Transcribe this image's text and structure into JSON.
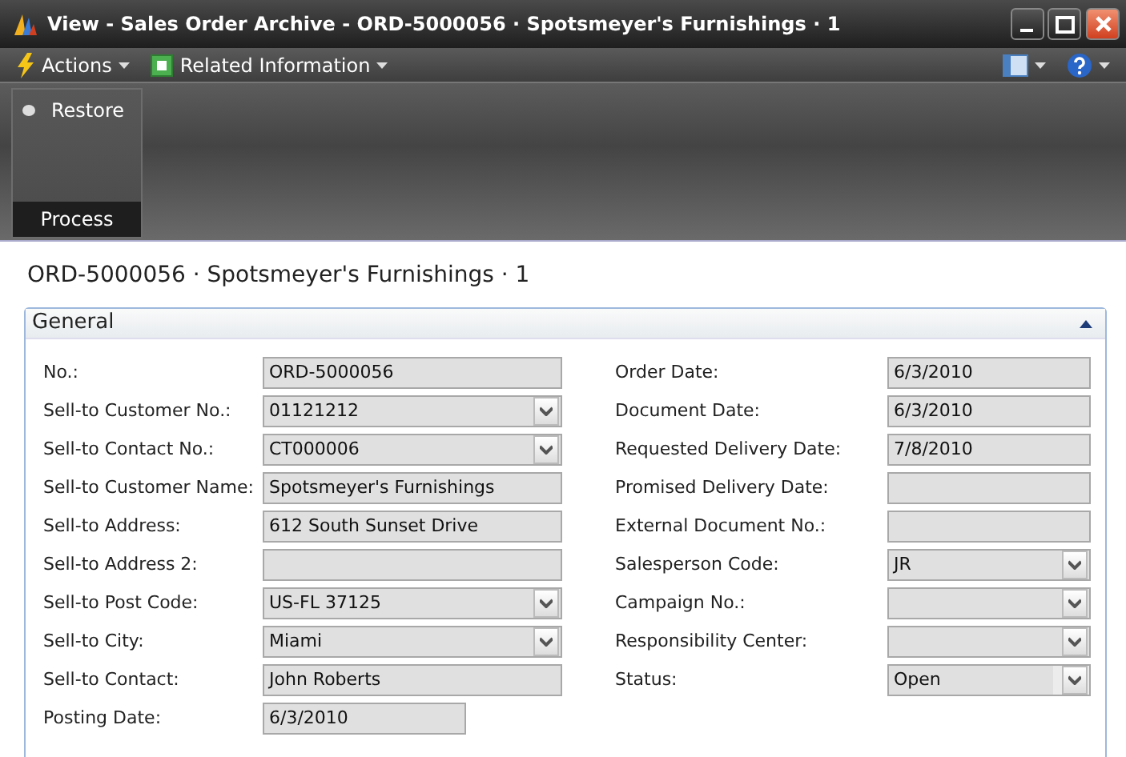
{
  "window": {
    "title": "View - Sales Order Archive - ORD-5000056 · Spotsmeyer's Furnishings · 1"
  },
  "toolbar": {
    "menus": [
      {
        "label": "Actions",
        "kind": "actions"
      },
      {
        "label": "Related Information",
        "kind": "related"
      }
    ]
  },
  "ribbon": {
    "groups": [
      {
        "label": "Process",
        "actions": [
          {
            "label": "Restore"
          }
        ]
      }
    ]
  },
  "page": {
    "title": "ORD-5000056 · Spotsmeyer's Furnishings · 1"
  },
  "fasttab": {
    "title": "General",
    "expanded": true,
    "columns": [
      [
        {
          "label": "No.:",
          "value": "ORD-5000056",
          "kind": "text"
        },
        {
          "label": "Sell-to Customer No.:",
          "value": "01121212",
          "kind": "lookup"
        },
        {
          "label": "Sell-to Contact No.:",
          "value": "CT000006",
          "kind": "lookup"
        },
        {
          "label": "Sell-to Customer Name:",
          "value": "Spotsmeyer's Furnishings",
          "kind": "text"
        },
        {
          "label": "Sell-to Address:",
          "value": "612 South Sunset Drive",
          "kind": "text"
        },
        {
          "label": "Sell-to Address 2:",
          "kind": "text"
        },
        {
          "label": "Sell-to Post Code:",
          "value": "US-FL 37125",
          "kind": "lookup"
        },
        {
          "label": "Sell-to City:",
          "value": "Miami",
          "kind": "lookup"
        },
        {
          "label": "Sell-to Contact:",
          "value": "John Roberts",
          "kind": "text"
        },
        {
          "label": "Posting Date:",
          "value": "6/3/2010",
          "kind": "date"
        }
      ],
      [
        {
          "label": "Order Date:",
          "value": "6/3/2010",
          "kind": "text"
        },
        {
          "label": "Document Date:",
          "value": "6/3/2010",
          "kind": "text"
        },
        {
          "label": "Requested Delivery Date:",
          "value": "7/8/2010",
          "kind": "text"
        },
        {
          "label": "Promised Delivery Date:",
          "kind": "text"
        },
        {
          "label": "External Document No.:",
          "kind": "text"
        },
        {
          "label": "Salesperson Code:",
          "value": "JR",
          "kind": "lookup"
        },
        {
          "label": "Campaign No.:",
          "kind": "lookup"
        },
        {
          "label": "Responsibility Center:",
          "kind": "lookup"
        },
        {
          "label": "Status:",
          "value": "Open",
          "kind": "option"
        }
      ]
    ]
  }
}
